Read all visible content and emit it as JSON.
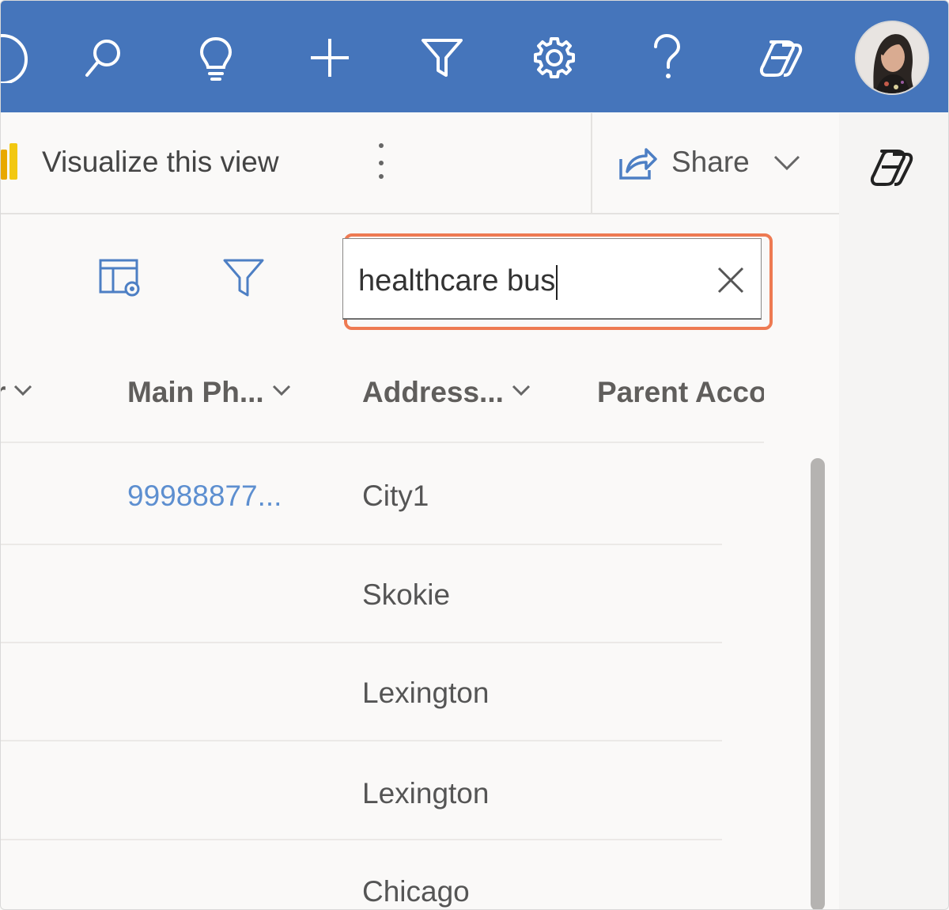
{
  "topbar": {
    "background": "#4575bb",
    "icons": [
      "circle-icon",
      "search-icon",
      "lightbulb-icon",
      "plus-icon",
      "filter-icon",
      "settings-icon",
      "help-icon",
      "copilot-icon"
    ],
    "avatar": "user-avatar"
  },
  "commandbar": {
    "visualize_label": "Visualize this view",
    "more_icon": "more-vertical-icon",
    "share_label": "Share",
    "share_icon": "share-icon",
    "chevron_icon": "chevron-down-icon"
  },
  "side_pane": {
    "copilot_icon": "copilot-icon"
  },
  "toolbar": {
    "edit_columns_icon": "edit-columns-icon",
    "filter_icon": "filter-icon",
    "search_value": "healthcare bus",
    "clear_icon": "close-icon",
    "highlight_color": "#ee7a52"
  },
  "grid": {
    "columns": [
      "r",
      "Main Ph...",
      "Address...",
      "Parent Acco"
    ],
    "rows": [
      {
        "main_phone": "99988877...",
        "address_city": "City1"
      },
      {
        "main_phone": "",
        "address_city": "Skokie"
      },
      {
        "main_phone": "",
        "address_city": "Lexington"
      },
      {
        "main_phone": "",
        "address_city": "Lexington"
      },
      {
        "main_phone": "",
        "address_city": "Chicago"
      }
    ]
  }
}
